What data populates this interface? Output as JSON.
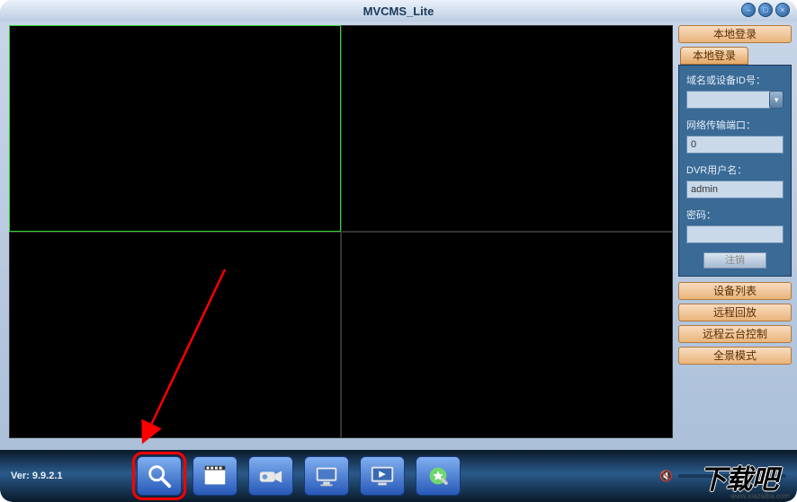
{
  "title": "MVCMS_Lite",
  "sidebar": {
    "login_header": "本地登录",
    "login_tab": "本地登录",
    "device_id_label": "域名或设备ID号：",
    "device_id_value": "",
    "port_label": "网络传输端口：",
    "port_value": "0",
    "username_label": "DVR用户名：",
    "username_value": "admin",
    "password_label": "密码：",
    "password_value": "",
    "logout_btn": "注销",
    "device_list_btn": "设备列表",
    "remote_playback_btn": "远程回放",
    "ptz_control_btn": "远程云台控制",
    "panorama_btn": "全景模式"
  },
  "bottom": {
    "version": "Ver: 9.9.2.1"
  },
  "toolbar": {
    "icons": [
      "search-icon",
      "film-icon",
      "camcorder-icon",
      "monitor-icon",
      "tv-icon",
      "settings-icon"
    ]
  },
  "logo": {
    "text": "下载吧",
    "url": "www.xiazaiba.com"
  }
}
